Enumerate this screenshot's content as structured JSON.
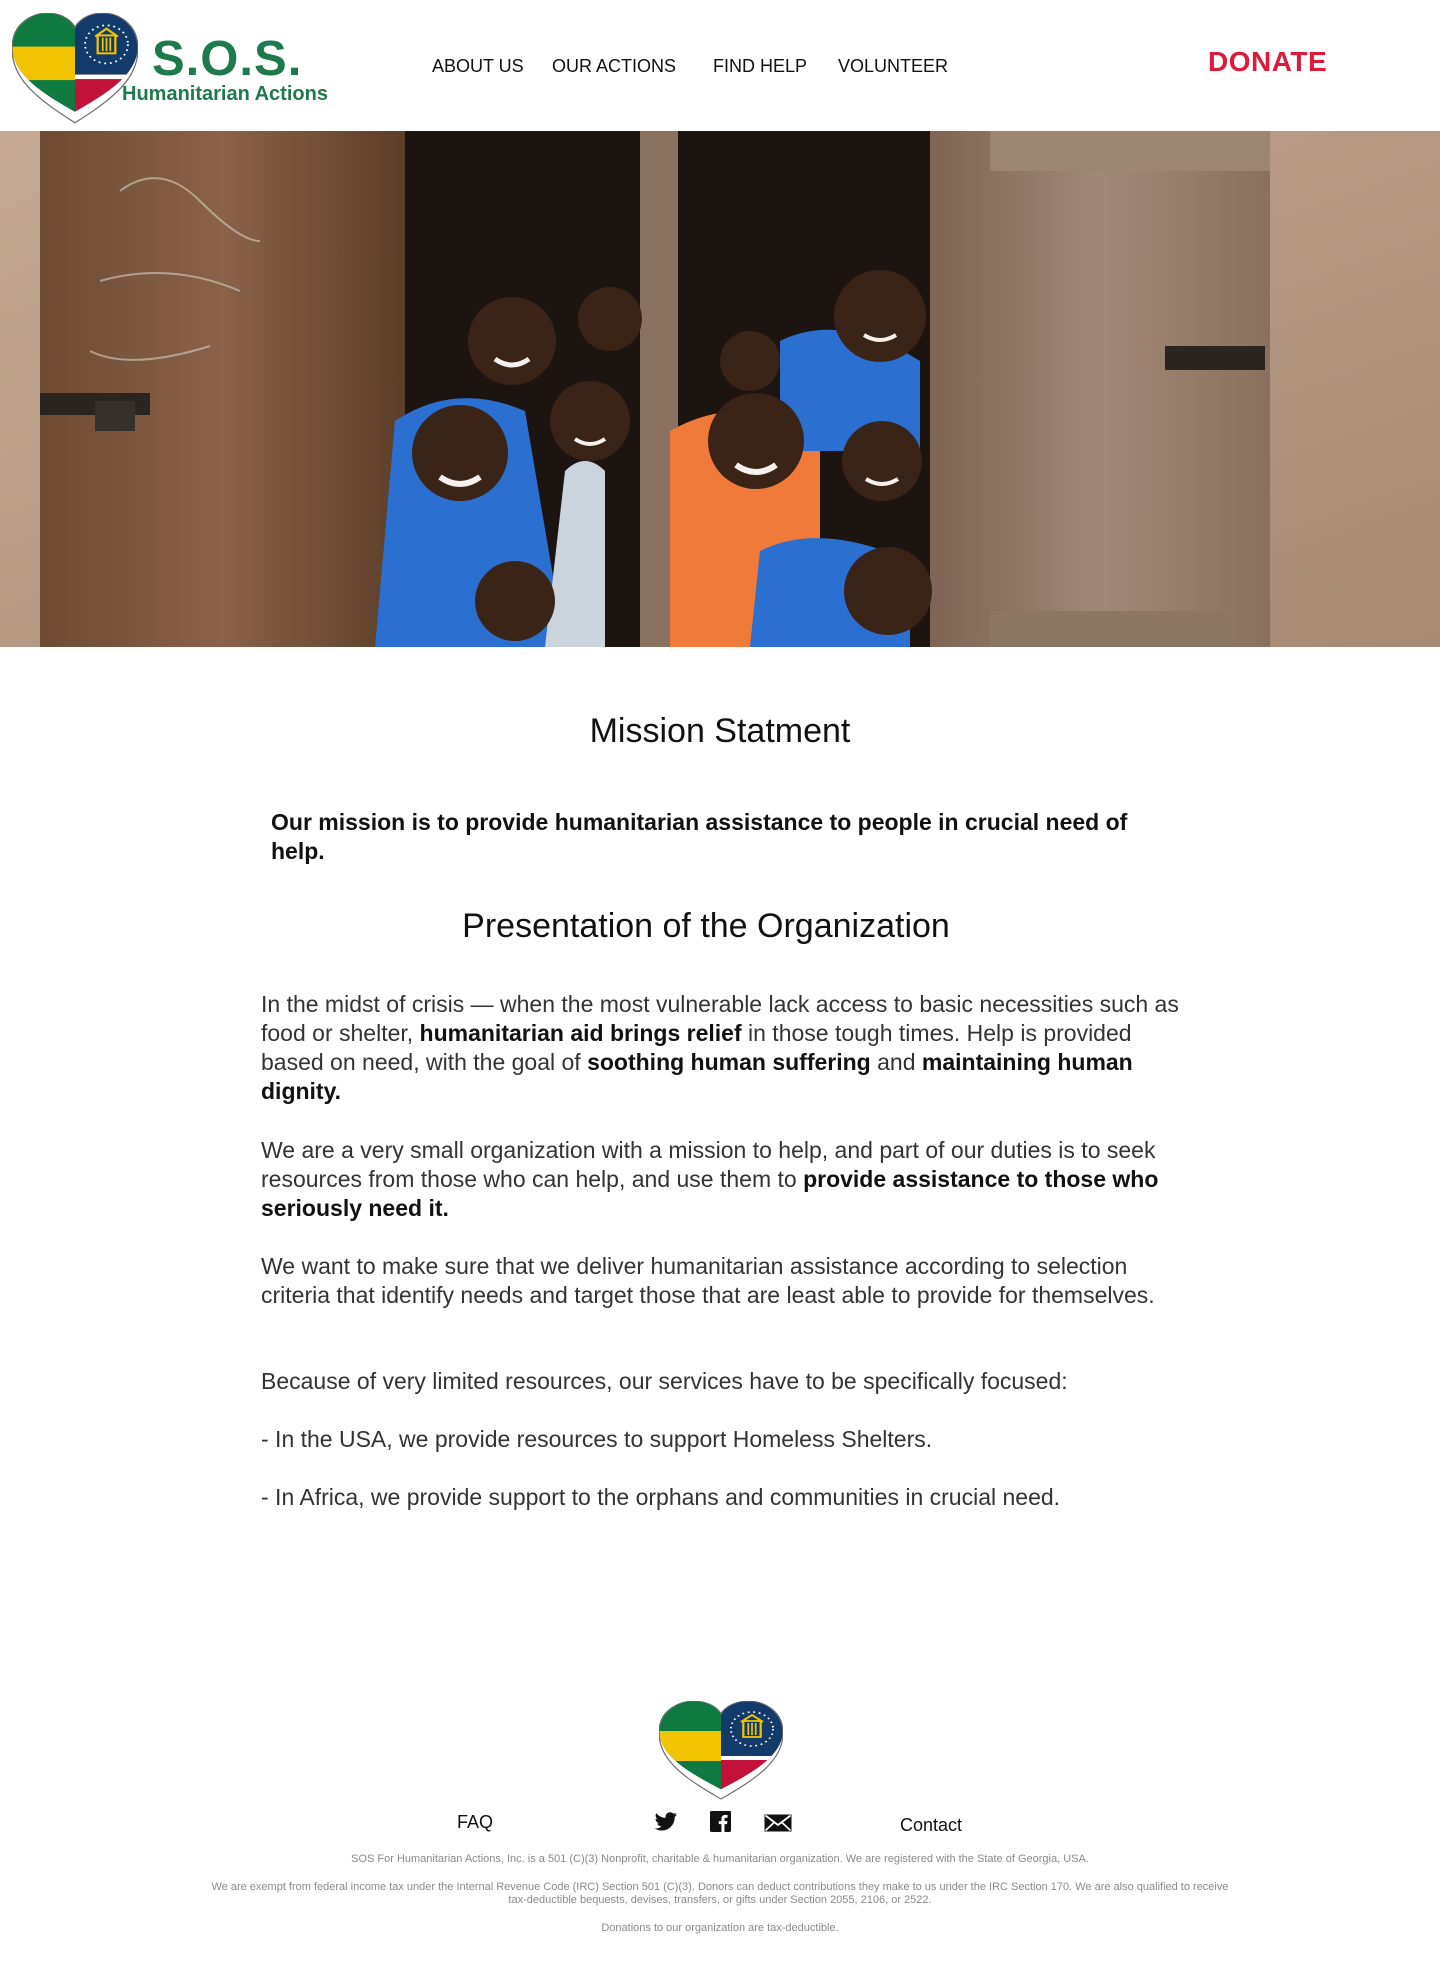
{
  "header": {
    "logo_title": "S.O.S.",
    "logo_subtitle": "Humanitarian Actions",
    "nav": [
      "ABOUT US",
      "OUR ACTIONS",
      "FIND HELP",
      "VOLUNTEER"
    ],
    "donate_label": "DONATE"
  },
  "colors": {
    "brand_green": "#1e7a4c",
    "donate_red": "#dc1b3a",
    "flag_green": "#0f7a3f",
    "flag_yellow": "#f2c300",
    "flag_navy": "#123a6b",
    "flag_red": "#c2123a"
  },
  "main": {
    "mission_heading": "Mission Statment",
    "mission_text": "Our mission is to provide humanitarian assistance to people in crucial need of help.",
    "presentation_heading": "Presentation of the Organization",
    "p1": {
      "a": "In the midst of crisis — when the most vulnerable lack access to basic necessities such as food or shelter, ",
      "b": "humanitarian aid brings relief",
      "c": " in those tough times. Help is provided based on need, with the goal of ",
      "d": "soothing human suffering",
      "e": " and ",
      "f": "maintaining human dignity."
    },
    "p2": {
      "a": "We are a very small organization with a mission to help, and part of our duties is to seek resources from those who can help, and use them to ",
      "b": "provide assistance to those who seriously need it."
    },
    "p3": "We want to make sure that we deliver humanitarian assistance according to selection criteria that identify needs and target those that are least able to provide for themselves.",
    "p4": "Because of very limited resources, our services have to be specifically focused:",
    "p5": "- In the USA, we provide resources to support Homeless Shelters.",
    "p6": "- In Africa, we provide support to the orphans and communities in crucial need."
  },
  "footer": {
    "faq": "FAQ",
    "contact": "Contact",
    "social_icons": [
      "twitter-icon",
      "facebook-icon",
      "email-icon"
    ],
    "fine1": "SOS For Humanitarian Actions, Inc. is a 501 (C)(3) Nonprofit, charitable & humanitarian organization. We are registered with the State of Georgia, USA.",
    "fine2a": "We are exempt from federal income tax under the Internal Revenue Code (IRC) Section 501 (C)(3). Donors can deduct contributions they make to us under the IRC Section 170. We are also qualified to receive",
    "fine2b": "tax-deductible bequests, devises, transfers, or gifts under Section 2055, 2106, or 2522.",
    "fine3": "Donations to our organization are tax-deductible."
  }
}
